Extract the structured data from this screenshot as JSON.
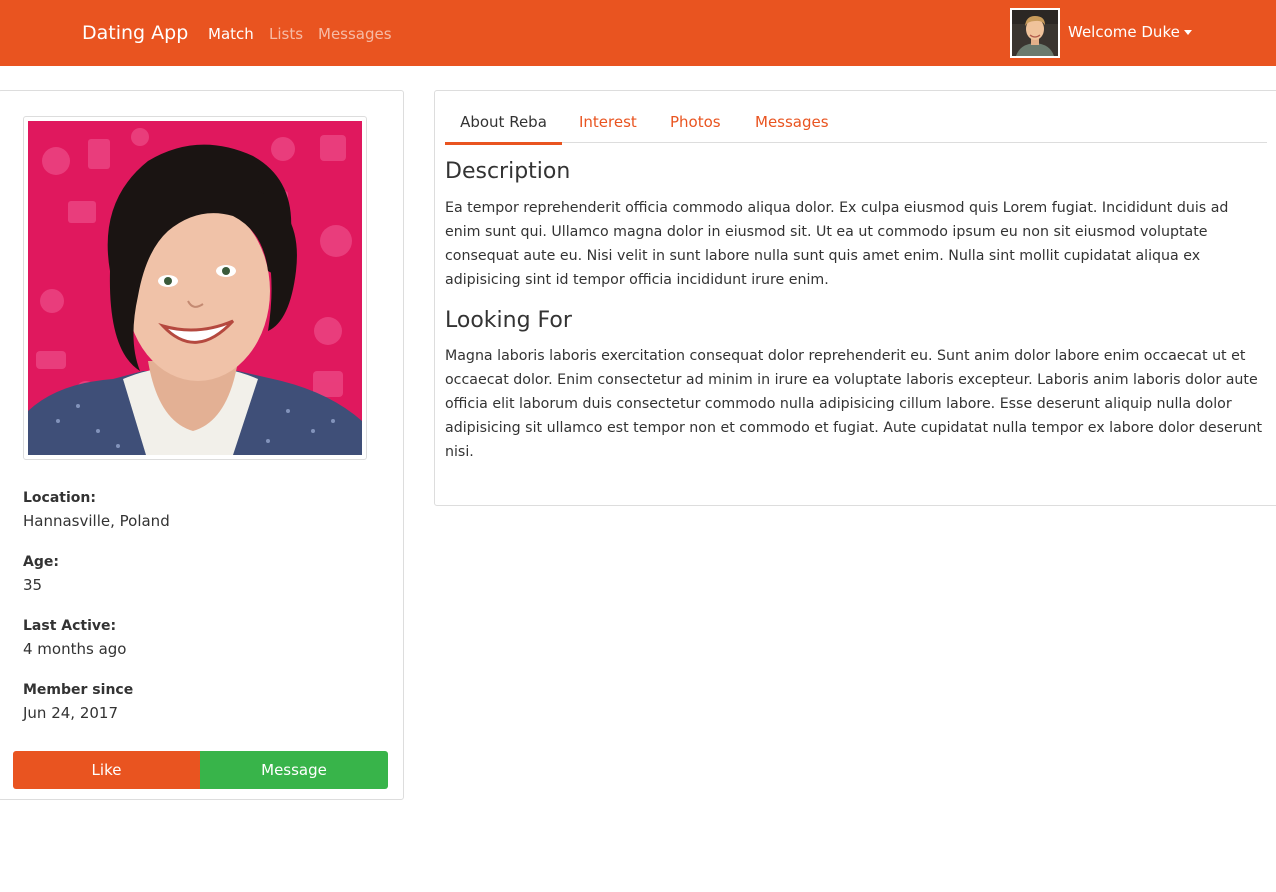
{
  "navbar": {
    "brand": "Dating App",
    "links": [
      "Match",
      "Lists",
      "Messages"
    ],
    "welcome": "Welcome Duke"
  },
  "profile": {
    "location_label": "Location:",
    "location": "Hannasville, Poland",
    "age_label": "Age:",
    "age": "35",
    "last_active_label": "Last Active:",
    "last_active": "4 months ago",
    "member_since_label": "Member since",
    "member_since": "Jun 24, 2017",
    "like_label": "Like",
    "message_label": "Message"
  },
  "tabs": [
    "About Reba",
    "Interest",
    "Photos",
    "Messages"
  ],
  "about": {
    "description_title": "Description",
    "description": "Ea tempor reprehenderit officia commodo aliqua dolor. Ex culpa eiusmod quis Lorem fugiat. Incididunt duis ad enim sunt qui. Ullamco magna dolor in eiusmod sit. Ut ea ut commodo ipsum eu non sit eiusmod voluptate consequat aute eu. Nisi velit in sunt labore nulla sunt quis amet enim. Nulla sint mollit cupidatat aliqua ex adipisicing sint id tempor officia incididunt irure enim.",
    "looking_for_title": "Looking For",
    "looking_for": "Magna laboris laboris exercitation consequat dolor reprehenderit eu. Sunt anim dolor labore enim occaecat ut et occaecat dolor. Enim consectetur ad minim in irure ea voluptate laboris excepteur. Laboris anim laboris dolor aute officia elit laborum duis consectetur commodo nulla adipisicing cillum labore. Esse deserunt aliquip nulla dolor adipisicing sit ullamco est tempor non et commodo et fugiat. Aute cupidatat nulla tempor ex labore dolor deserunt nisi."
  },
  "colors": {
    "primary": "#E95420",
    "success": "#38B44A",
    "photo_background": "#E0185E"
  }
}
